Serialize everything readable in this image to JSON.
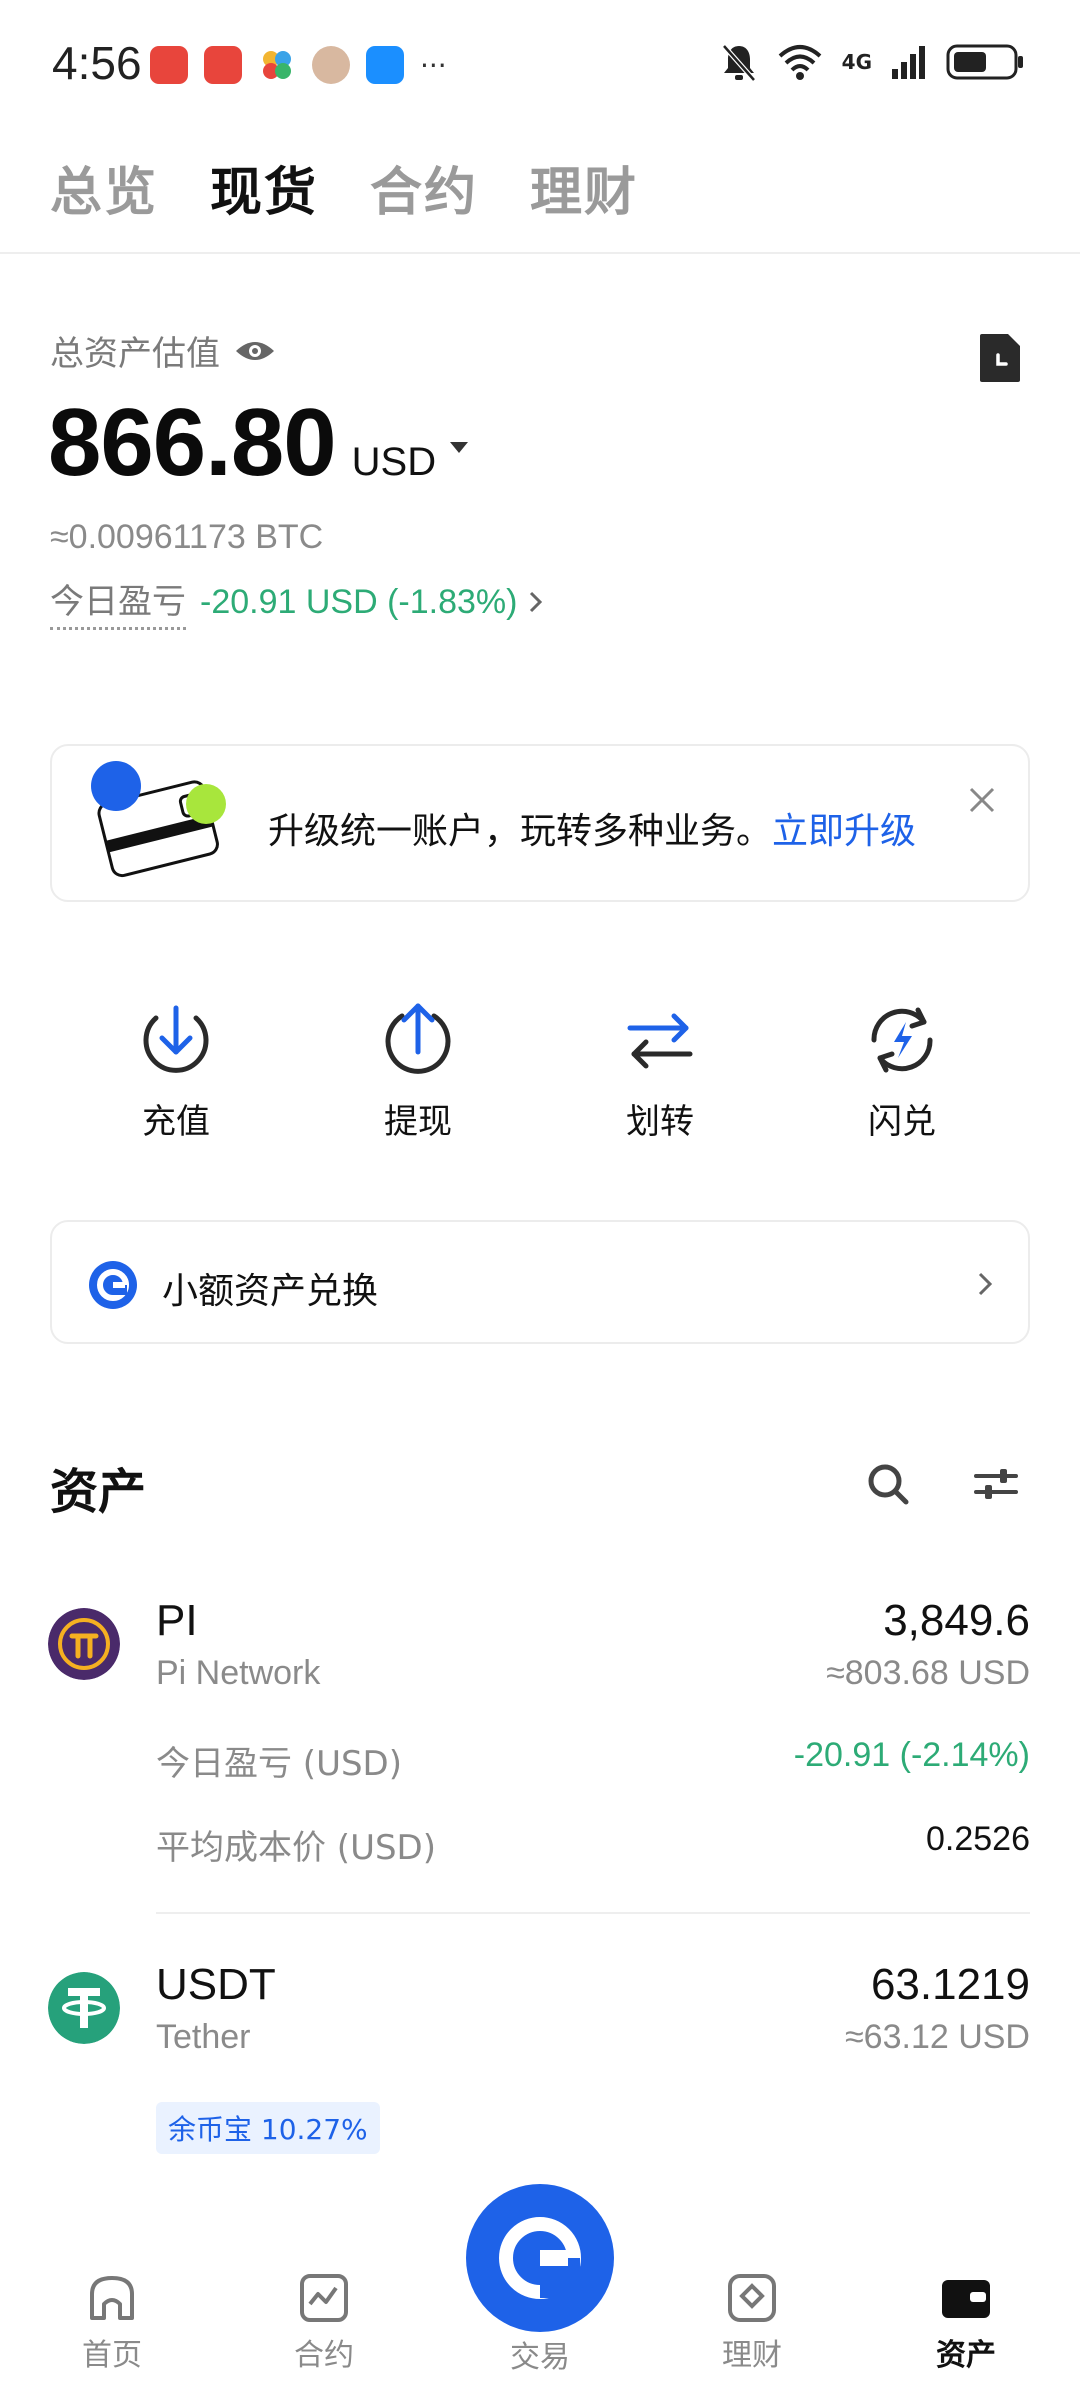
{
  "status_bar": {
    "time": "4:56",
    "notifications": [
      "app-icon-red",
      "huawei-store-icon",
      "pinwheel-icon",
      "avatar-icon",
      "message-icon"
    ],
    "more": "···",
    "network": "4G"
  },
  "top_tabs": [
    {
      "label": "总览",
      "active": false
    },
    {
      "label": "现货",
      "active": true
    },
    {
      "label": "合约",
      "active": false
    },
    {
      "label": "理财",
      "active": false
    }
  ],
  "summary": {
    "estimate_label": "总资产估值",
    "total": "866.80",
    "currency": "USD",
    "btc_estimate": "≈0.00961173 BTC",
    "today_pnl_label": "今日盈亏",
    "today_pnl_value": "-20.91 USD (-1.83%)"
  },
  "banner": {
    "text": "升级统一账户，玩转多种业务。",
    "link": "立即升级"
  },
  "actions": [
    {
      "label": "充值",
      "icon": "deposit-icon"
    },
    {
      "label": "提现",
      "icon": "withdraw-icon"
    },
    {
      "label": "划转",
      "icon": "transfer-icon"
    },
    {
      "label": "闪兑",
      "icon": "flash-swap-icon"
    }
  ],
  "small_exchange": {
    "label": "小额资产兑换"
  },
  "assets": {
    "title": "资产",
    "items": [
      {
        "symbol": "PI",
        "name": "Pi Network",
        "amount": "3,849.6",
        "usd": "≈803.68 USD",
        "pnl_label": "今日盈亏 (USD)",
        "pnl_value": "-20.91 (-2.14%)",
        "avg_cost_label": "平均成本价 (USD)",
        "avg_cost_value": "0.2526"
      },
      {
        "symbol": "USDT",
        "name": "Tether",
        "amount": "63.1219",
        "usd": "≈63.12 USD",
        "badge": "余币宝 10.27%"
      }
    ]
  },
  "bottom_nav": [
    {
      "label": "首页",
      "icon": "home-icon",
      "active": false
    },
    {
      "label": "合约",
      "icon": "futures-icon",
      "active": false
    },
    {
      "label": "交易",
      "icon": "trade-icon",
      "active": false
    },
    {
      "label": "理财",
      "icon": "earn-icon",
      "active": false
    },
    {
      "label": "资产",
      "icon": "wallet-icon",
      "active": true
    }
  ],
  "colors": {
    "accent": "#1e62e8",
    "positive_text": "#2dab76",
    "pi_purple": "#4a2a6a",
    "pi_gold": "#f5b021",
    "tether_green": "#26a17b"
  }
}
